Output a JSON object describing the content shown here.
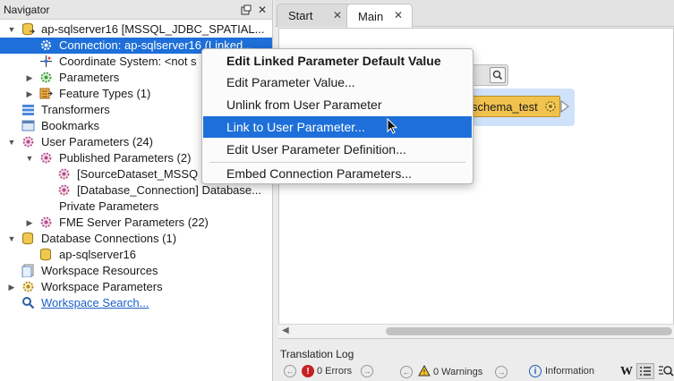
{
  "navigator": {
    "title": "Navigator",
    "items": [
      {
        "label": "ap-sqlserver16 [MSSQL_JDBC_SPATIAL..."
      },
      {
        "label": "Connection: ap-sqlserver16 (Linked..."
      },
      {
        "label": "Coordinate System: <not s"
      },
      {
        "label": "Parameters"
      },
      {
        "label": "Feature Types (1)"
      },
      {
        "label": "Transformers"
      },
      {
        "label": "Bookmarks"
      },
      {
        "label": "User Parameters (24)"
      },
      {
        "label": "Published Parameters (2)"
      },
      {
        "label": "[SourceDataset_MSSQ"
      },
      {
        "label": "[Database_Connection] Database..."
      },
      {
        "label": "Private Parameters"
      },
      {
        "label": "FME Server Parameters (22)"
      },
      {
        "label": "Database Connections (1)"
      },
      {
        "label": "ap-sqlserver16"
      },
      {
        "label": "Workspace Resources"
      },
      {
        "label": "Workspace Parameters"
      },
      {
        "label": "Workspace Search..."
      }
    ]
  },
  "tabs": [
    {
      "label": "Start"
    },
    {
      "label": "Main"
    }
  ],
  "canvas": {
    "node_label": "schema_test"
  },
  "context_menu": {
    "items": [
      {
        "label": "Edit Linked Parameter Default Value"
      },
      {
        "label": "Edit Parameter Value..."
      },
      {
        "label": "Unlink from User Parameter"
      },
      {
        "label": "Link to User Parameter..."
      },
      {
        "label": "Edit User Parameter Definition..."
      },
      {
        "label": "Embed Connection Parameters..."
      }
    ]
  },
  "translation_log": {
    "title": "Translation Log",
    "errors": "0 Errors",
    "warnings": "0 Warnings",
    "information": "Information"
  },
  "colors": {
    "selection": "#1e6fd9",
    "node": "#f2c24e",
    "canvas_highlight": "#cfe2fa"
  }
}
